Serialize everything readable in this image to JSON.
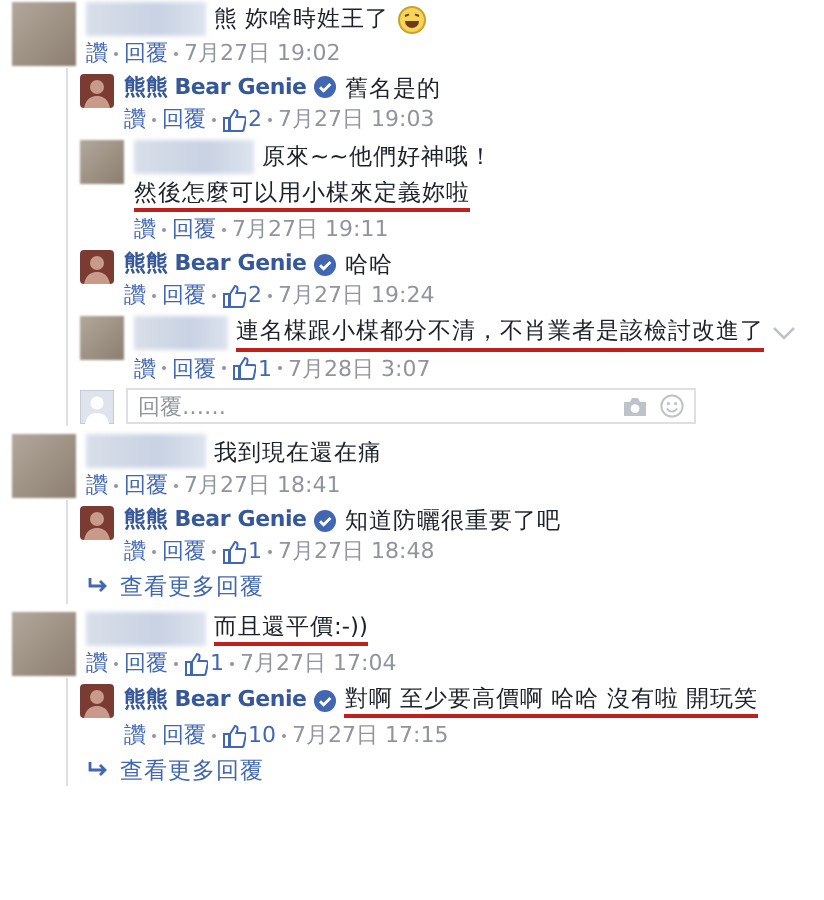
{
  "threads": [
    {
      "comment": {
        "author": {
          "kind": "hidden"
        },
        "lines": [
          {
            "text": "熊 妳啥時姓王了",
            "underlined": false
          }
        ],
        "emoji": true,
        "like_label": "讚",
        "reply_label": "回覆",
        "date": "7月27日 19:02"
      },
      "replies": [
        {
          "author": {
            "kind": "named",
            "name": "熊熊 Bear Genie",
            "verified": true
          },
          "lines": [
            {
              "text": "舊名是的",
              "underlined": false
            }
          ],
          "like_label": "讚",
          "reply_label": "回覆",
          "likes": "2",
          "date": "7月27日 19:03"
        },
        {
          "author": {
            "kind": "hidden"
          },
          "lines": [
            {
              "text": "原來~~他們好神哦！",
              "underlined": false
            },
            {
              "text": "然後怎麼可以用小楳來定義妳啦",
              "underlined": true
            }
          ],
          "like_label": "讚",
          "reply_label": "回覆",
          "date": "7月27日 19:11"
        },
        {
          "author": {
            "kind": "named",
            "name": "熊熊 Bear Genie",
            "verified": true
          },
          "lines": [
            {
              "text": "哈哈",
              "underlined": false
            }
          ],
          "like_label": "讚",
          "reply_label": "回覆",
          "likes": "2",
          "date": "7月27日 19:24"
        },
        {
          "author": {
            "kind": "hidden"
          },
          "lines": [
            {
              "text": "連名楳跟小楳都分不清，不肖業者是該檢討改進了",
              "underlined": true
            }
          ],
          "menu": true,
          "like_label": "讚",
          "reply_label": "回覆",
          "likes": "1",
          "date": "7月28日 3:07"
        }
      ],
      "reply_box": {
        "placeholder": "回覆……"
      }
    },
    {
      "comment": {
        "author": {
          "kind": "hidden"
        },
        "lines": [
          {
            "text": "我到現在還在痛",
            "underlined": false
          }
        ],
        "like_label": "讚",
        "reply_label": "回覆",
        "date": "7月27日 18:41"
      },
      "replies": [
        {
          "author": {
            "kind": "named",
            "name": "熊熊 Bear Genie",
            "verified": true
          },
          "lines": [
            {
              "text": "知道防曬很重要了吧",
              "underlined": false
            }
          ],
          "like_label": "讚",
          "reply_label": "回覆",
          "likes": "1",
          "date": "7月27日 18:48"
        }
      ],
      "more_replies": "查看更多回覆"
    },
    {
      "comment": {
        "author": {
          "kind": "hidden"
        },
        "lines": [
          {
            "text": "而且還平價:-))",
            "underlined": true
          }
        ],
        "like_label": "讚",
        "reply_label": "回覆",
        "likes": "1",
        "date": "7月27日 17:04"
      },
      "replies": [
        {
          "author": {
            "kind": "named",
            "name": "熊熊 Bear Genie",
            "verified": true
          },
          "lines": [
            {
              "text": "對啊 至少要高價啊 哈哈 沒有啦 開玩笑",
              "underlined": true
            }
          ],
          "like_label": "讚",
          "reply_label": "回覆",
          "likes": "10",
          "date": "7月27日 17:15"
        }
      ],
      "more_replies": "查看更多回覆"
    }
  ]
}
